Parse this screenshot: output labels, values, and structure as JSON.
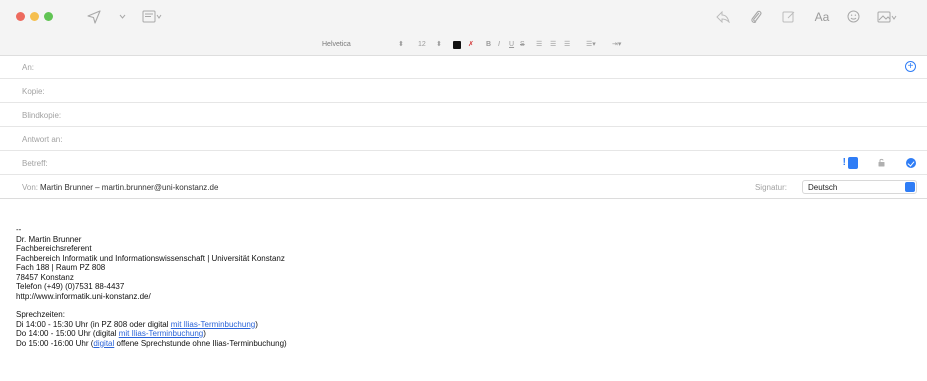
{
  "toolbar": {
    "icons": [
      "send-icon",
      "header-fields-icon",
      "reply-icon",
      "attachment-icon",
      "markup-icon",
      "fonts-icon",
      "emoji-icon",
      "photo-icon"
    ],
    "font_button": "Aa"
  },
  "format_bar": {
    "font": "Helvetica",
    "size": "12",
    "bold": "B",
    "italic": "I",
    "underline": "U",
    "strikethrough": "S"
  },
  "fields": {
    "to": {
      "label": "An:",
      "value": ""
    },
    "cc": {
      "label": "Kopie:",
      "value": ""
    },
    "bcc": {
      "label": "Blindkopie:",
      "value": ""
    },
    "reply_to": {
      "label": "Antwort an:",
      "value": ""
    },
    "subject": {
      "label": "Betreff:",
      "value": "",
      "priority": "!"
    },
    "from": {
      "label": "Von:",
      "value": "Martin Brunner – martin.brunner@uni-konstanz.de"
    },
    "signature": {
      "label": "Signatur:",
      "value": "Deutsch"
    }
  },
  "body": {
    "separator": "--",
    "name": "Dr. Martin Brunner",
    "role": "Fachbereichsreferent",
    "department": "Fachbereich Informatik und Informationswissenschaft | Universität Konstanz",
    "room": "Fach 188 | Raum PZ 808",
    "city": "78457 Konstanz",
    "phone": "Telefon (+49) (0)7531 88-4437",
    "website": "http://www.informatik.uni-konstanz.de/",
    "hours_title": "Sprechzeiten:",
    "hours_1_pre": "Di 14:00 - 15:30 Uhr (in PZ 808 oder digital ",
    "hours_1_link": "mit Ilias-Terminbuchung",
    "hours_1_post": ")",
    "hours_2_pre": "Do 14:00 - 15:00 Uhr (digital ",
    "hours_2_link": "mit Ilias-Terminbuchung",
    "hours_2_post": ")",
    "hours_3_pre": "Do 15:00 -16:00 Uhr (",
    "hours_3_link": "digital",
    "hours_3_post": " offene Sprechstunde ohne Ilias-Terminbuchung)"
  },
  "colors": {
    "accent": "#2f7df6",
    "link": "#2a63d8"
  }
}
